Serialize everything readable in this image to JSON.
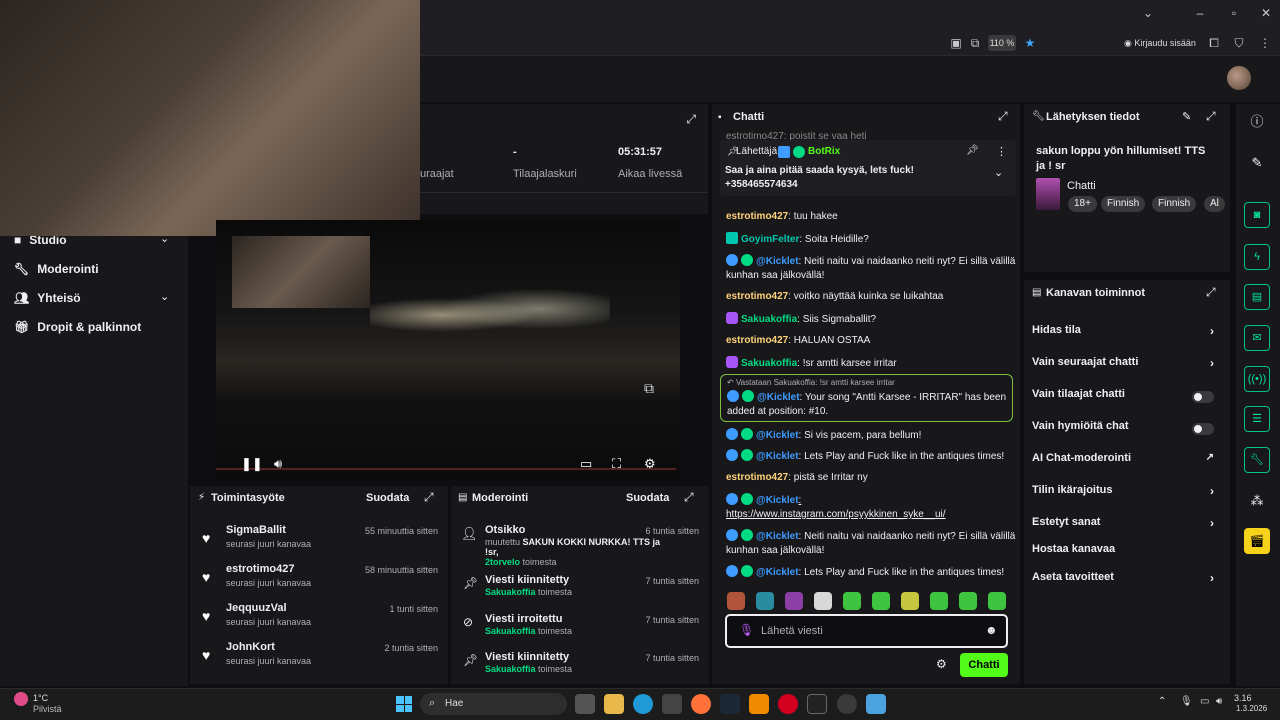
{
  "browser": {
    "zoom": "110 %",
    "signin": "Kirjaudu sisään"
  },
  "nav": {
    "items": [
      {
        "label": "Studio",
        "icon": "studio-icon"
      },
      {
        "label": "Moderointi",
        "icon": "wrench-icon"
      },
      {
        "label": "Yhteisö",
        "icon": "people-icon"
      },
      {
        "label": "Dropit & palkinnot",
        "icon": "gift-icon"
      }
    ]
  },
  "stats": {
    "followers_label": "uraajat",
    "subs_value": "-",
    "subs_label": "Tilaajalaskuri",
    "time_value": "05:31:57",
    "time_label": "Aikaa livessä"
  },
  "activity": {
    "title": "Toimintasyöte",
    "filter": "Suodata",
    "items": [
      {
        "name": "SigmaBallit",
        "action": "seurasi juuri kanavaa",
        "time": "55 minuuttia sitten"
      },
      {
        "name": "estrotimo427",
        "action": "seurasi juuri kanavaa",
        "time": "58 minuuttia sitten"
      },
      {
        "name": "JeqquuzVal",
        "action": "seurasi juuri kanavaa",
        "time": "1 tunti sitten"
      },
      {
        "name": "JohnKort",
        "action": "seurasi juuri kanavaa",
        "time": "2 tuntia sitten"
      }
    ]
  },
  "moderation": {
    "title": "Moderointi",
    "filter": "Suodata",
    "items": [
      {
        "title": "Otsikko",
        "line1_pre": "muutettu",
        "line1_bold": "SAKUN KOKKI NURKKA! TTS ja !sr,",
        "actor": "2torvelo",
        "suffix": "toimesta",
        "time": "6 tuntia sitten"
      },
      {
        "title": "Viesti kiinnitetty",
        "actor": "Sakuakoffia",
        "suffix": "toimesta",
        "time": "7 tuntia sitten"
      },
      {
        "title": "Viesti irroitettu",
        "actor": "Sakuakoffia",
        "suffix": "toimesta",
        "time": "7 tuntia sitten"
      },
      {
        "title": "Viesti kiinnitetty",
        "actor": "Sakuakoffia",
        "suffix": "toimesta",
        "time": "7 tuntia sitten"
      }
    ]
  },
  "chat": {
    "title": "Chatti",
    "top_partial": "estrotimo427: poistit se vaa heti",
    "pinned": {
      "label": "Lähettäjä",
      "sender": "BotRix",
      "text": "Saa ja aina pitää saada kysyä, lets fuck! +358465574634"
    },
    "messages": [
      {
        "user": "estrotimo427",
        "text": ": tuu hakee"
      },
      {
        "user": "GoyimFelter",
        "text": ": Soita Heidille?"
      },
      {
        "user": "@Kicklet",
        "text": ": Neiti naitu vai naidaanko neiti nyt? Ei sillä välillä kunhan saa jälkovällä!"
      },
      {
        "user": "estrotimo427",
        "text": ": voitko näyttää kuinka se luikahtaa"
      },
      {
        "user": "Sakuakoffia",
        "text": ": Siis Sigmaballit?"
      },
      {
        "user": "estrotimo427",
        "text": ": HALUAN OSTAA"
      },
      {
        "user": "Sakuakoffia",
        "text": ": !sr amtti karsee irritar"
      },
      {
        "user": "@Kicklet",
        "text": ": Si vis pacem, para bellum!"
      },
      {
        "user": "@Kicklet",
        "text": ": Lets Play and Fuck like in the antiques times!"
      },
      {
        "user": "estrotimo427",
        "text": ": pistä se Irritar ny"
      },
      {
        "user": "@Kicklet",
        "text": ": https://www.instagram.com/psyykkinen_syke__ui/"
      },
      {
        "user": "@Kicklet",
        "text": ": Neiti naitu vai naidaanko neiti nyt? Ei sillä välillä kunhan saa jälkovällä!"
      },
      {
        "user": "@Kicklet",
        "text": ": Lets Play and Fuck like in the antiques times!"
      }
    ],
    "reply": {
      "context": "Vastataan Sakuakoffia: !sr amtti karsee irritar",
      "user": "@Kicklet",
      "text": ": Your song \"Antti Karsee - IRRITAR\" has been added at position: #10."
    },
    "input_placeholder": "Lähetä viesti",
    "send_label": "Chatti"
  },
  "stream_info": {
    "title": "Lähetyksen tiedot",
    "stream_title": "sakun loppu yön hillumiset! TTS ja ! sr",
    "category": "Chatti",
    "tags": [
      "18+",
      "Finnish",
      "Finnish",
      "Al"
    ]
  },
  "channel_actions": {
    "title": "Kanavan toiminnot",
    "items": [
      {
        "label": "Hidas tila",
        "control": "chevron"
      },
      {
        "label": "Vain seuraajat chatti",
        "control": "chevron"
      },
      {
        "label": "Vain tilaajat chatti",
        "control": "toggle"
      },
      {
        "label": "Vain hymiöitä chat",
        "control": "toggle"
      },
      {
        "label": "AI Chat-moderointi",
        "control": "external"
      },
      {
        "label": "Tilin ikärajoitus",
        "control": "chevron"
      },
      {
        "label": "Estetyt sanat",
        "control": "chevron"
      },
      {
        "label": "Hostaa kanavaa",
        "control": "none"
      },
      {
        "label": "Aseta tavoitteet",
        "control": "chevron"
      }
    ]
  },
  "taskbar": {
    "weather_temp": "1°C",
    "weather_desc": "Pilvistä",
    "search": "Hae",
    "time": "3.16",
    "date": "1.3.2026"
  },
  "colors": {
    "accent": "#53fc18",
    "panel": "#18181b",
    "background": "#0e0e10"
  }
}
